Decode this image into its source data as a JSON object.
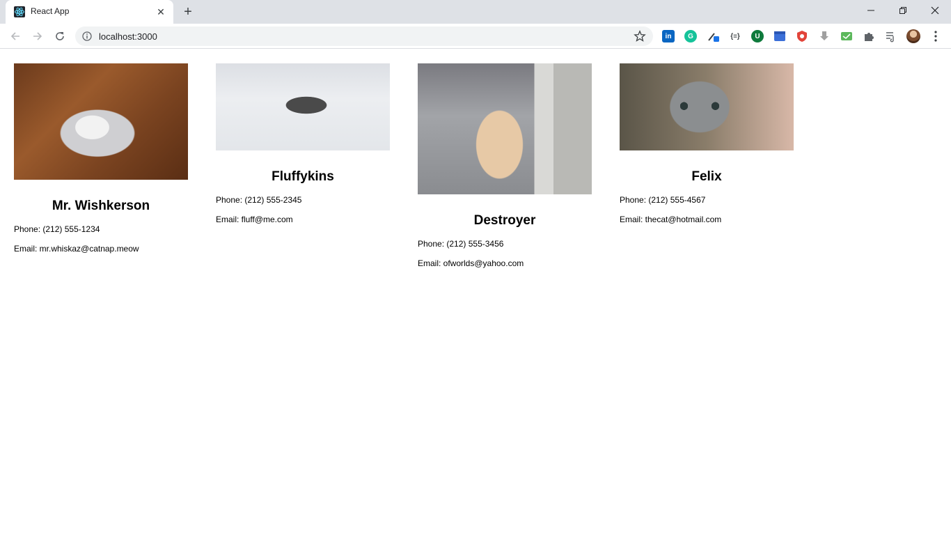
{
  "browser": {
    "tab_title": "React App",
    "tab_close": "✕",
    "new_tab": "+",
    "url": "localhost:3000"
  },
  "extensions": [
    {
      "icon": "linkedin-icon",
      "label": "in",
      "color": "#0a66c2"
    },
    {
      "icon": "grammarly-icon",
      "label": "G",
      "color": "#15c39a"
    },
    {
      "icon": "color-picker-icon",
      "label": "",
      "color": "#1a73e8"
    },
    {
      "icon": "json-viewer-icon",
      "label": "{≡}",
      "color": "#3c4043"
    },
    {
      "icon": "ublock-icon",
      "label": "U",
      "color": "#0f7a3c"
    },
    {
      "icon": "calendar-icon",
      "label": "",
      "color": "#3b6fd8"
    },
    {
      "icon": "shield-red-icon",
      "label": "",
      "color": "#e2443a"
    },
    {
      "icon": "download-icon",
      "label": "",
      "color": "#a0a0a0"
    },
    {
      "icon": "inbox-icon",
      "label": "",
      "color": "#5cb85c"
    },
    {
      "icon": "puzzle-icon",
      "label": "",
      "color": "#5f6368"
    },
    {
      "icon": "media-queue-icon",
      "label": "",
      "color": "#5f6368"
    }
  ],
  "cats": [
    {
      "name": "Mr. Wishkerson",
      "phone": "Phone: (212) 555-1234",
      "email": "Email: mr.whiskaz@catnap.meow"
    },
    {
      "name": "Fluffykins",
      "phone": "Phone: (212) 555-2345",
      "email": "Email: fluff@me.com"
    },
    {
      "name": "Destroyer",
      "phone": "Phone: (212) 555-3456",
      "email": "Email: ofworlds@yahoo.com"
    },
    {
      "name": "Felix",
      "phone": "Phone: (212) 555-4567",
      "email": "Email: thecat@hotmail.com"
    }
  ]
}
